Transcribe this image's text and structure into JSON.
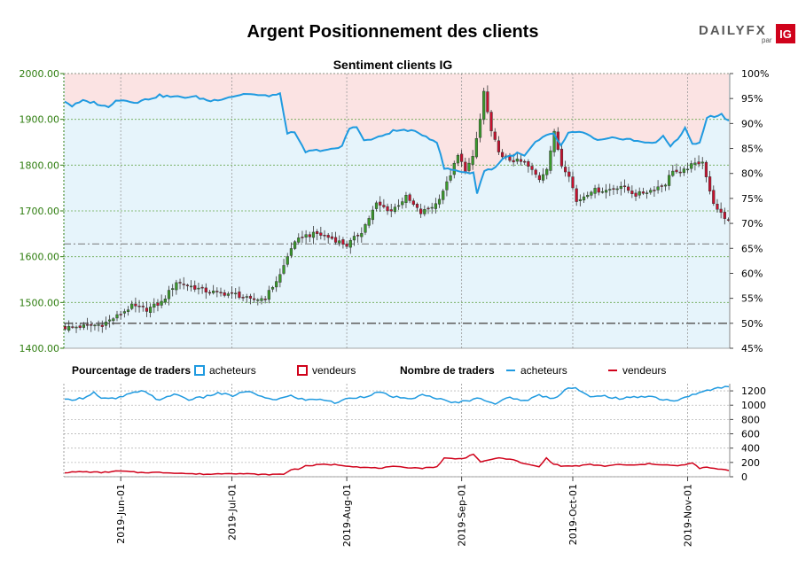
{
  "chart_data": [
    {
      "type": "candlestick",
      "title": "Argent Positionnement des clients",
      "subtitle": "Sentiment clients IG",
      "price_axis": {
        "range": [
          1400,
          2000
        ],
        "ticks": [
          "1400.00",
          "1500.00",
          "1600.00",
          "1700.00",
          "1800.00",
          "1900.00",
          "2000.00"
        ]
      },
      "percent_axis": {
        "range": [
          45,
          100
        ],
        "ticks": [
          "45%",
          "50%",
          "55%",
          "60%",
          "65%",
          "70%",
          "75%",
          "80%",
          "85%",
          "90%",
          "95%",
          "100%"
        ]
      },
      "reference_lines": {
        "price_dash_dot": 1628,
        "percent_50": 50
      },
      "legend": {
        "pct_header": "Pourcentage de traders",
        "pct_buyers": "acheteurs",
        "pct_sellers": "vendeurs",
        "count_header": "Nombre de traders",
        "count_buyers": "acheteurs",
        "count_sellers": "vendeurs"
      },
      "date_ticks": [
        "2019-Jun-01",
        "2019-Jul-01",
        "2019-Aug-01",
        "2019-Sep-01",
        "2019-Oct-01",
        "2019-Nov-01"
      ],
      "date_tick_index": [
        15,
        45,
        76,
        107,
        137,
        168
      ],
      "n_days": 180,
      "price_close_keypoints": [
        [
          0,
          1445
        ],
        [
          5,
          1448
        ],
        [
          10,
          1452
        ],
        [
          14,
          1470
        ],
        [
          18,
          1492
        ],
        [
          22,
          1485
        ],
        [
          26,
          1500
        ],
        [
          30,
          1545
        ],
        [
          34,
          1535
        ],
        [
          38,
          1525
        ],
        [
          42,
          1520
        ],
        [
          46,
          1518
        ],
        [
          50,
          1505
        ],
        [
          54,
          1510
        ],
        [
          58,
          1560
        ],
        [
          61,
          1620
        ],
        [
          64,
          1645
        ],
        [
          68,
          1650
        ],
        [
          72,
          1640
        ],
        [
          76,
          1625
        ],
        [
          80,
          1655
        ],
        [
          84,
          1715
        ],
        [
          88,
          1700
        ],
        [
          92,
          1730
        ],
        [
          96,
          1695
        ],
        [
          100,
          1715
        ],
        [
          103,
          1760
        ],
        [
          106,
          1820
        ],
        [
          108,
          1790
        ],
        [
          110,
          1815
        ],
        [
          112,
          1900
        ],
        [
          113,
          1960
        ],
        [
          115,
          1870
        ],
        [
          118,
          1815
        ],
        [
          120,
          1812
        ],
        [
          124,
          1805
        ],
        [
          128,
          1770
        ],
        [
          130,
          1795
        ],
        [
          132,
          1870
        ],
        [
          134,
          1800
        ],
        [
          136,
          1780
        ],
        [
          138,
          1720
        ],
        [
          142,
          1745
        ],
        [
          146,
          1745
        ],
        [
          150,
          1755
        ],
        [
          154,
          1735
        ],
        [
          158,
          1745
        ],
        [
          162,
          1760
        ],
        [
          164,
          1790
        ],
        [
          166,
          1780
        ],
        [
          168,
          1795
        ],
        [
          172,
          1810
        ],
        [
          174,
          1740
        ],
        [
          176,
          1700
        ],
        [
          178,
          1685
        ],
        [
          179,
          1680
        ]
      ],
      "buyers_pct_keypoints": [
        [
          0,
          94.5
        ],
        [
          2,
          93.5
        ],
        [
          5,
          94.5
        ],
        [
          8,
          94.2
        ],
        [
          12,
          93.2
        ],
        [
          14,
          94.8
        ],
        [
          20,
          94.3
        ],
        [
          26,
          95.6
        ],
        [
          30,
          95.3
        ],
        [
          36,
          95.3
        ],
        [
          40,
          94.5
        ],
        [
          45,
          95.3
        ],
        [
          50,
          96.0
        ],
        [
          54,
          95.5
        ],
        [
          59,
          95.8
        ],
        [
          61,
          88.2
        ],
        [
          63,
          88.0
        ],
        [
          66,
          84.3
        ],
        [
          70,
          84.7
        ],
        [
          74,
          84.8
        ],
        [
          76,
          85.5
        ],
        [
          78,
          89.0
        ],
        [
          80,
          89.5
        ],
        [
          82,
          86.5
        ],
        [
          86,
          87.2
        ],
        [
          90,
          88.5
        ],
        [
          94,
          88.7
        ],
        [
          98,
          87.8
        ],
        [
          102,
          86.3
        ],
        [
          104,
          81.0
        ],
        [
          108,
          80.5
        ],
        [
          112,
          80.0
        ],
        [
          113,
          76.2
        ],
        [
          115,
          80.5
        ],
        [
          118,
          81.2
        ],
        [
          120,
          83.0
        ],
        [
          124,
          84.0
        ],
        [
          126,
          83.5
        ],
        [
          129,
          86.2
        ],
        [
          132,
          87.5
        ],
        [
          134,
          88.0
        ],
        [
          136,
          85.5
        ],
        [
          138,
          88.0
        ],
        [
          142,
          88.3
        ],
        [
          146,
          86.5
        ],
        [
          150,
          87.0
        ],
        [
          154,
          87.0
        ],
        [
          158,
          86.2
        ],
        [
          162,
          86.3
        ],
        [
          164,
          87.3
        ],
        [
          166,
          85.5
        ],
        [
          168,
          87.0
        ],
        [
          170,
          89.0
        ],
        [
          172,
          86.0
        ],
        [
          174,
          86.0
        ],
        [
          176,
          91.2
        ],
        [
          180,
          91.8
        ],
        [
          182,
          90.5
        ]
      ],
      "buyers_count_keypoints": [
        [
          0,
          1070
        ],
        [
          5,
          1100
        ],
        [
          8,
          1180
        ],
        [
          10,
          1090
        ],
        [
          14,
          1090
        ],
        [
          18,
          1160
        ],
        [
          22,
          1200
        ],
        [
          26,
          1060
        ],
        [
          30,
          1160
        ],
        [
          34,
          1080
        ],
        [
          38,
          1110
        ],
        [
          42,
          1170
        ],
        [
          46,
          1130
        ],
        [
          50,
          1200
        ],
        [
          54,
          1110
        ],
        [
          58,
          1080
        ],
        [
          62,
          1130
        ],
        [
          66,
          1070
        ],
        [
          70,
          1090
        ],
        [
          74,
          1030
        ],
        [
          78,
          1100
        ],
        [
          82,
          1120
        ],
        [
          86,
          1180
        ],
        [
          90,
          1120
        ],
        [
          94,
          1080
        ],
        [
          98,
          1140
        ],
        [
          102,
          1100
        ],
        [
          106,
          1030
        ],
        [
          110,
          1060
        ],
        [
          114,
          1100
        ],
        [
          118,
          1020
        ],
        [
          122,
          1110
        ],
        [
          126,
          1060
        ],
        [
          130,
          1140
        ],
        [
          134,
          1090
        ],
        [
          138,
          1250
        ],
        [
          140,
          1240
        ],
        [
          144,
          1110
        ],
        [
          148,
          1130
        ],
        [
          152,
          1090
        ],
        [
          156,
          1110
        ],
        [
          160,
          1130
        ],
        [
          164,
          1080
        ],
        [
          168,
          1060
        ],
        [
          172,
          1150
        ],
        [
          176,
          1200
        ],
        [
          180,
          1250
        ],
        [
          182,
          1260
        ]
      ],
      "sellers_count_keypoints": [
        [
          0,
          60
        ],
        [
          5,
          70
        ],
        [
          10,
          60
        ],
        [
          15,
          80
        ],
        [
          20,
          60
        ],
        [
          25,
          60
        ],
        [
          30,
          55
        ],
        [
          35,
          40
        ],
        [
          40,
          35
        ],
        [
          45,
          50
        ],
        [
          50,
          40
        ],
        [
          55,
          30
        ],
        [
          60,
          35
        ],
        [
          62,
          100
        ],
        [
          64,
          110
        ],
        [
          66,
          150
        ],
        [
          70,
          170
        ],
        [
          74,
          170
        ],
        [
          78,
          150
        ],
        [
          82,
          130
        ],
        [
          86,
          120
        ],
        [
          90,
          140
        ],
        [
          94,
          130
        ],
        [
          98,
          120
        ],
        [
          102,
          140
        ],
        [
          104,
          260
        ],
        [
          108,
          250
        ],
        [
          110,
          270
        ],
        [
          112,
          320
        ],
        [
          114,
          200
        ],
        [
          118,
          260
        ],
        [
          122,
          250
        ],
        [
          126,
          180
        ],
        [
          130,
          140
        ],
        [
          132,
          260
        ],
        [
          134,
          180
        ],
        [
          136,
          150
        ],
        [
          140,
          150
        ],
        [
          144,
          170
        ],
        [
          148,
          150
        ],
        [
          152,
          170
        ],
        [
          156,
          160
        ],
        [
          160,
          180
        ],
        [
          164,
          170
        ],
        [
          168,
          150
        ],
        [
          172,
          190
        ],
        [
          174,
          120
        ],
        [
          176,
          130
        ],
        [
          180,
          100
        ],
        [
          182,
          90
        ]
      ],
      "count_axis": {
        "range": [
          0,
          1300
        ],
        "ticks": [
          "0",
          "200",
          "400",
          "600",
          "800",
          "1000",
          "1200"
        ]
      }
    }
  ],
  "logo": {
    "brand": "DAILYFX",
    "sub": "par",
    "badge": "IG"
  },
  "colors": {
    "green": "#2e7d0f",
    "red": "#d0021b",
    "blue": "#1f9ae0",
    "upper_fill": "#fbe3e3",
    "lower_fill": "#e6f4fb",
    "candle_up": "#3a9b2b",
    "candle_down": "#c8102e"
  }
}
